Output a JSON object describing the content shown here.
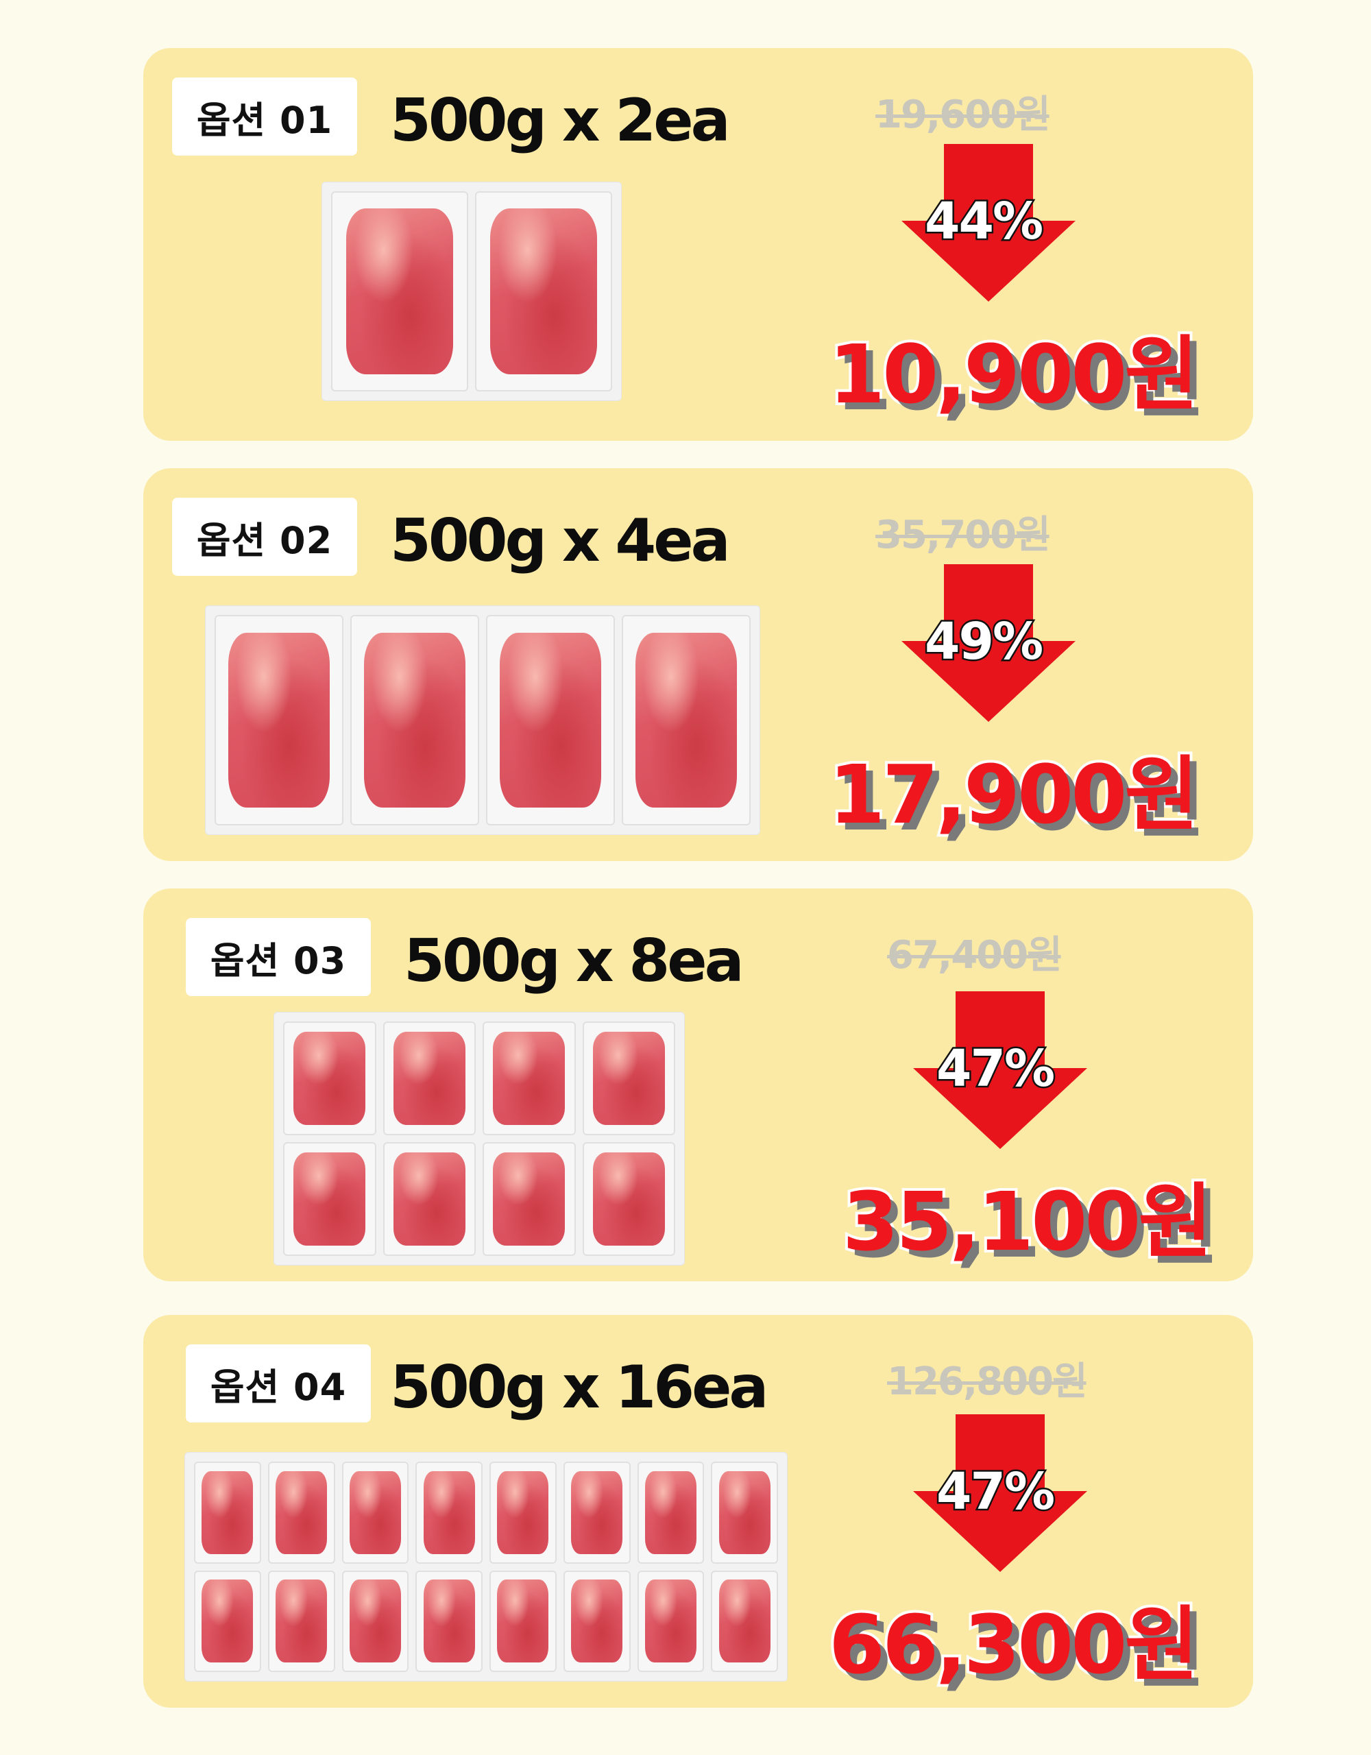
{
  "options": [
    {
      "label": "옵션 01",
      "qty": "500g x 2ea",
      "original_price": "19,600원",
      "discount": "44%",
      "price": "10,900원",
      "pack_count": 2
    },
    {
      "label": "옵션 02",
      "qty": "500g x 4ea",
      "original_price": "35,700원",
      "discount": "49%",
      "price": "17,900원",
      "pack_count": 4
    },
    {
      "label": "옵션 03",
      "qty": "500g x 8ea",
      "original_price": "67,400원",
      "discount": "47%",
      "price": "35,100원",
      "pack_count": 8
    },
    {
      "label": "옵션 04",
      "qty": "500g x 16ea",
      "original_price": "126,800원",
      "discount": "47%",
      "price": "66,300원",
      "pack_count": 16
    }
  ],
  "colors": {
    "page_background": "#fdfbec",
    "card_background": "#fbeaa6",
    "arrow_red": "#e8141c",
    "price_red": "#f0161e",
    "original_price_grey": "#c9c6bb"
  },
  "icons": {
    "arrow": "down-arrow-icon"
  }
}
